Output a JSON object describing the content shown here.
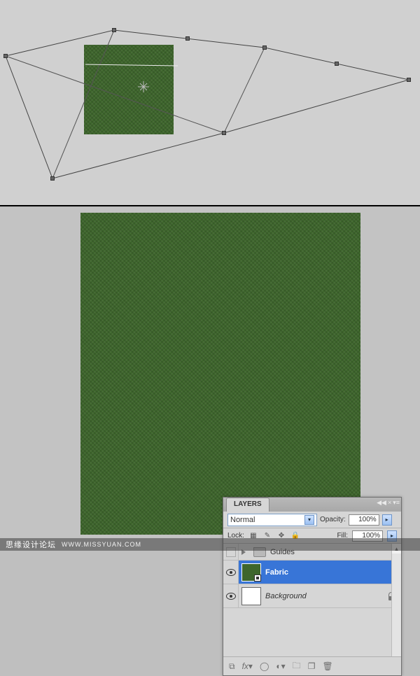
{
  "panel": {
    "title": "LAYERS",
    "blend_mode": "Normal",
    "opacity_label": "Opacity:",
    "opacity_value": "100%",
    "lock_label": "Lock:",
    "fill_label": "Fill:",
    "fill_value": "100%"
  },
  "layers": {
    "group": {
      "name": "Guides"
    },
    "fabric": {
      "name": "Fabric"
    },
    "background": {
      "name": "Background"
    }
  },
  "watermark": {
    "site_cn": "思缘设计论坛",
    "url": "WWW.MISSYUAN.COM"
  }
}
